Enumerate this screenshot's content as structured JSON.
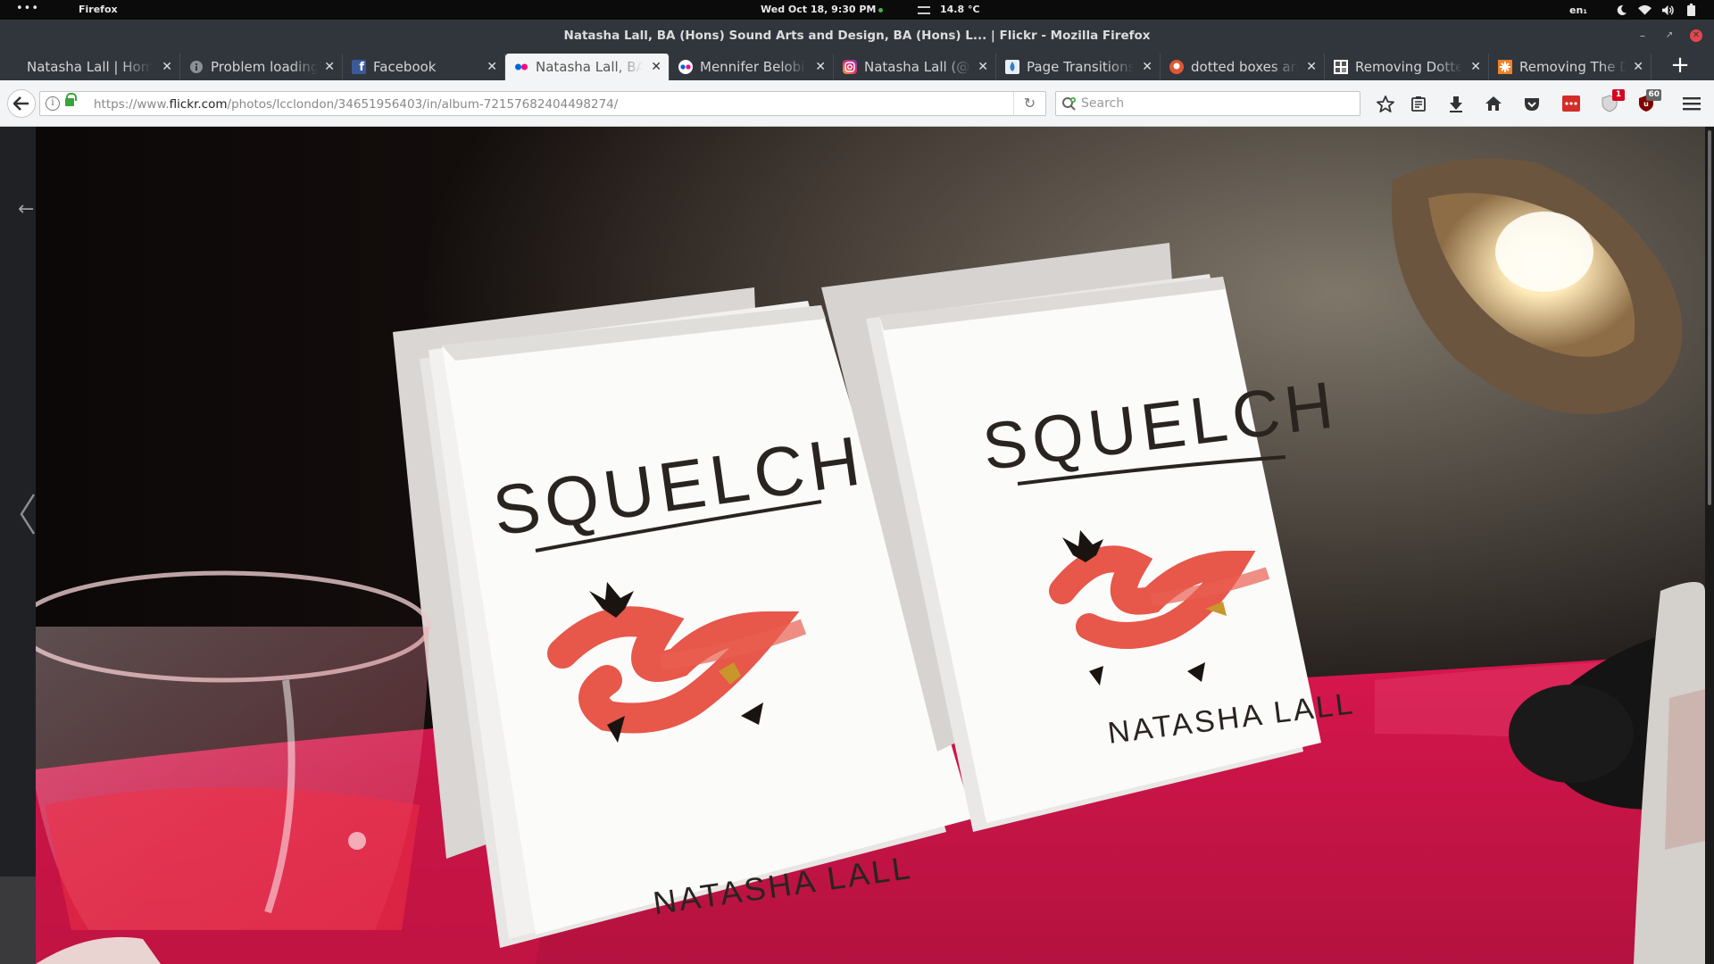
{
  "system_bar": {
    "activities": "•••",
    "app_name": "Firefox",
    "clock": "Wed Oct 18,  9:30 PM",
    "weather": "14.8 °C",
    "keyboard_layout": "en₁"
  },
  "window": {
    "title": "Natasha Lall, BA (Hons) Sound Arts and Design, BA (Hons) L... | Flickr - Mozilla Firefox"
  },
  "tabs": [
    {
      "label": "Natasha Lall | Home",
      "icon": "none",
      "active": false
    },
    {
      "label": "Problem loading page",
      "icon": "info-icon",
      "active": false
    },
    {
      "label": "Facebook",
      "icon": "facebook-icon",
      "active": false
    },
    {
      "label": "Natasha Lall, BA (Hons)",
      "icon": "flickr-icon",
      "active": true
    },
    {
      "label": "Mennifer Belobi",
      "icon": "flickr-icon",
      "active": false
    },
    {
      "label": "Natasha Lall (@lit",
      "icon": "instagram-icon",
      "active": false
    },
    {
      "label": "Page Transitions",
      "icon": "drop-icon",
      "active": false
    },
    {
      "label": "dotted boxes around",
      "icon": "duckduckgo-icon",
      "active": false
    },
    {
      "label": "Removing Dotted",
      "icon": "grid-icon",
      "active": false
    },
    {
      "label": "Removing The Dotted",
      "icon": "asterisk-icon",
      "active": false
    }
  ],
  "navbar": {
    "url_prefix": "https://www.",
    "url_domain": "flickr.com",
    "url_path": "/photos/lcclondon/34651956403/in/album-72157682404498274/",
    "search_placeholder": "Search",
    "badge_privacy": "1",
    "badge_ublock": "60"
  },
  "colors": {
    "chrome_dark": "#31363d",
    "toolbar": "#f3f4f5",
    "secure_lock": "#3aa33a",
    "badge_red": "#d70022"
  },
  "photo": {
    "book_title": "SQUELCH",
    "book_author": "NATASHA LALL"
  }
}
